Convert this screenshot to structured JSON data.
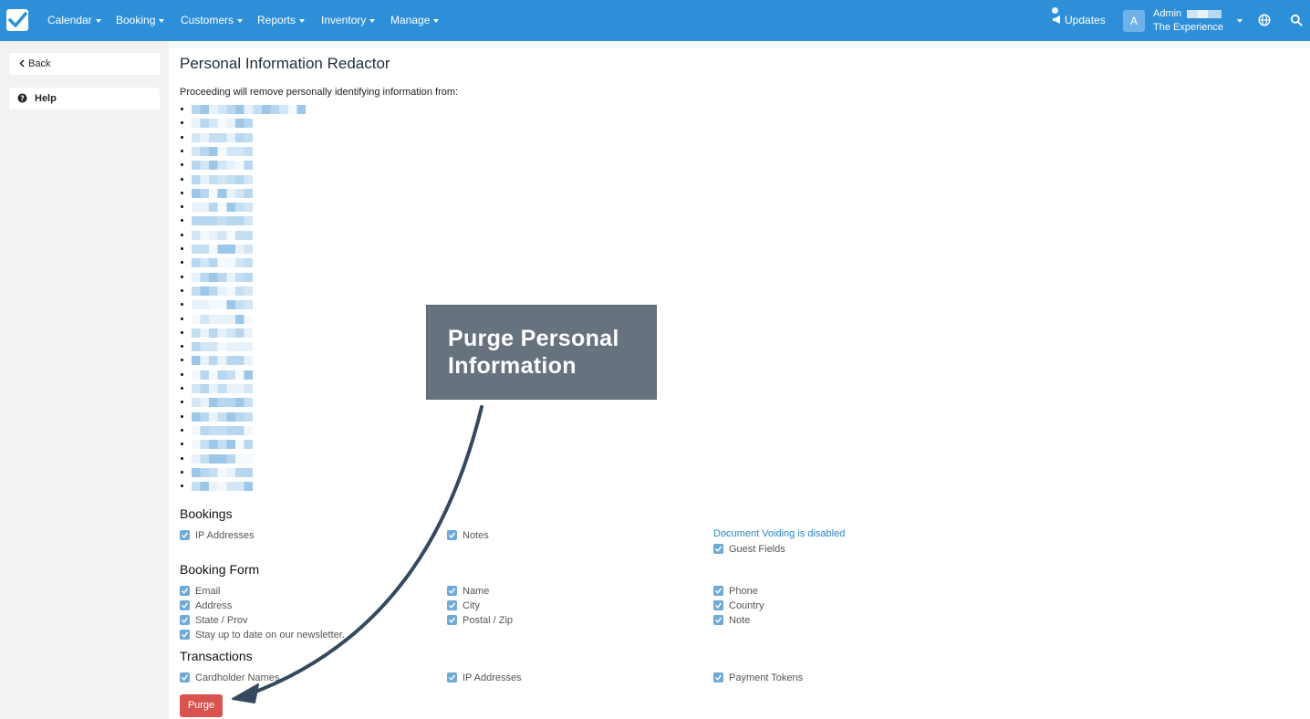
{
  "nav": {
    "items": [
      "Calendar",
      "Booking",
      "Customers",
      "Reports",
      "Inventory",
      "Manage"
    ],
    "updates": "Updates",
    "avatar_letter": "A",
    "user_name": "Admin",
    "company": "The Experience",
    "icons": [
      "check-logo-icon",
      "megaphone-icon",
      "globe-icon",
      "search-icon"
    ]
  },
  "sidebar": {
    "back": "Back",
    "help": "Help"
  },
  "main": {
    "title": "Personal Information Redactor",
    "intro": "Proceeding will remove personally identifying information from:",
    "redacted_count": 28,
    "sections": {
      "bookings": {
        "title": "Bookings",
        "ip": "IP Addresses",
        "notes": "Notes",
        "voiding": "Document Voiding is disabled",
        "guest_fields": "Guest Fields"
      },
      "booking_form": {
        "title": "Booking Form",
        "email": "Email",
        "name": "Name",
        "phone": "Phone",
        "address": "Address",
        "city": "City",
        "country": "Country",
        "state": "State / Prov",
        "postal": "Postal / Zip",
        "note": "Note",
        "newsletter": "Stay up to date on our newsletter."
      },
      "transactions": {
        "title": "Transactions",
        "cardholder": "Cardholder Names",
        "ip": "IP Addresses",
        "tokens": "Payment Tokens"
      }
    },
    "purge": "Purge"
  },
  "callout": {
    "line1": "Purge Personal",
    "line2": "Information"
  },
  "colors": {
    "nav_bg": "#2d8fd8",
    "purge_btn": "#d9534f",
    "callout_bg": "#66737f",
    "checkbox": "#6fa9d6",
    "arrow": "#34495e"
  }
}
